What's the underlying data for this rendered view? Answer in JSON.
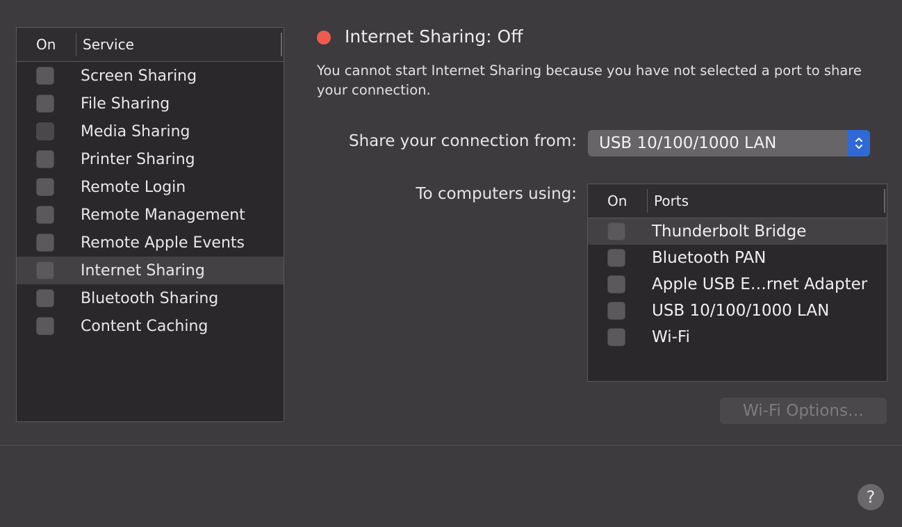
{
  "services": {
    "header_on": "On",
    "header_service": "Service",
    "items": [
      {
        "label": "Screen Sharing",
        "checked": false
      },
      {
        "label": "File Sharing",
        "checked": false
      },
      {
        "label": "Media Sharing",
        "checked": false
      },
      {
        "label": "Printer Sharing",
        "checked": false
      },
      {
        "label": "Remote Login",
        "checked": false
      },
      {
        "label": "Remote Management",
        "checked": false
      },
      {
        "label": "Remote Apple Events",
        "checked": false
      },
      {
        "label": "Internet Sharing",
        "checked": false,
        "selected": true
      },
      {
        "label": "Bluetooth Sharing",
        "checked": false
      },
      {
        "label": "Content Caching",
        "checked": false
      }
    ]
  },
  "detail": {
    "status_title": "Internet Sharing: Off",
    "status_color": "#ef5b4f",
    "description": "You cannot start Internet Sharing because you have not selected a port to share your connection.",
    "share_from_label": "Share your connection from:",
    "share_from_value": "USB 10/100/1000 LAN",
    "to_computers_label": "To computers using:",
    "ports": {
      "header_on": "On",
      "header_ports": "Ports",
      "items": [
        {
          "label": "Thunderbolt Bridge",
          "checked": false,
          "selected": true
        },
        {
          "label": "Bluetooth PAN",
          "checked": false
        },
        {
          "label": "Apple USB E…rnet Adapter",
          "checked": false
        },
        {
          "label": "USB 10/100/1000 LAN",
          "checked": false
        },
        {
          "label": "Wi-Fi",
          "checked": false
        }
      ]
    },
    "wifi_options_label": "Wi-Fi Options…"
  },
  "footer": {
    "help_label": "?"
  },
  "accent_color": "#2e69d6"
}
